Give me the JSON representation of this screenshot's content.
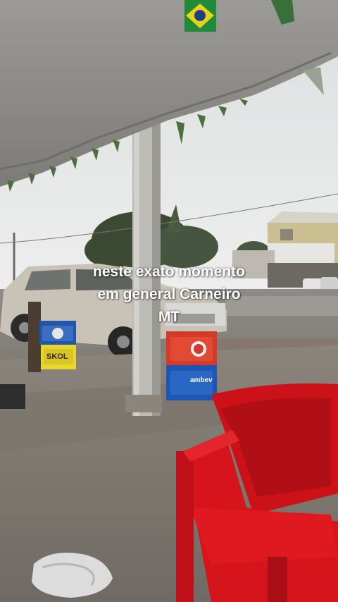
{
  "caption": {
    "line1": "neste exato momento",
    "line2": "em general Carneiro",
    "line3": "MT"
  },
  "crate_labels": {
    "yellow_crate": "SKOL",
    "blue_crate": "ambev"
  },
  "colors": {
    "sky": "#e6e7e8",
    "roof": "#8e8e8c",
    "floor": "#7f7a72",
    "chair": "#d4121a",
    "caption_text": "#ffffff"
  }
}
